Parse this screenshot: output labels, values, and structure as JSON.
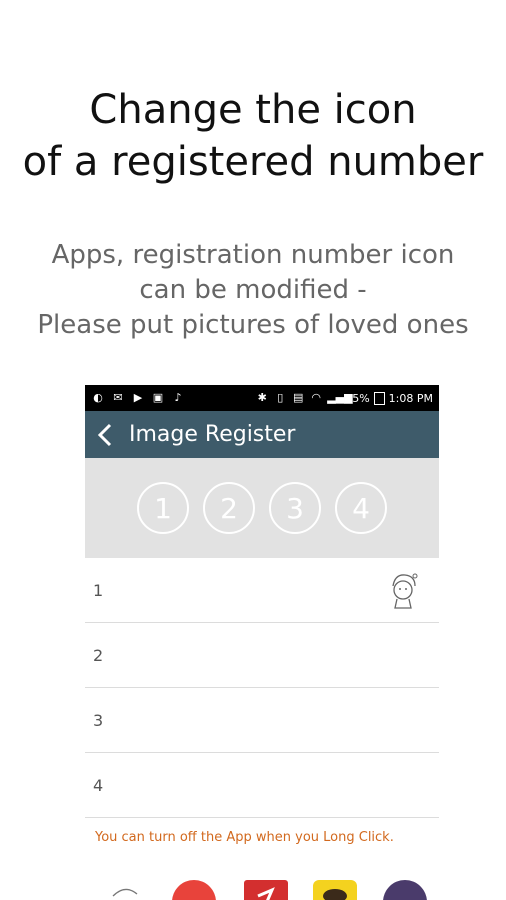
{
  "headline": {
    "line1": "Change the icon",
    "line2": "of a registered number"
  },
  "subtitle": {
    "line1": "Apps, registration number icon",
    "line2": "can be modified -",
    "line3": "Please put pictures of loved ones"
  },
  "statusbar": {
    "battery": "85%",
    "time": "1:08 PM"
  },
  "appbar": {
    "title": "Image Register"
  },
  "slots": [
    "1",
    "2",
    "3",
    "4"
  ],
  "rows": [
    {
      "number": "1",
      "icon": "character-avatar-icon"
    },
    {
      "number": "2"
    },
    {
      "number": "3"
    },
    {
      "number": "4"
    }
  ],
  "hint": "You can turn off the App when you Long Click.",
  "dock_apps": [
    "character-app-icon",
    "red-circle-app-icon",
    "red-app-icon",
    "yellow-talk-app-icon",
    "photo-app-icon"
  ],
  "colors": {
    "appbar": "#3e5b6a",
    "slots_background": "#e2e2e2",
    "hint": "#d2691e"
  }
}
